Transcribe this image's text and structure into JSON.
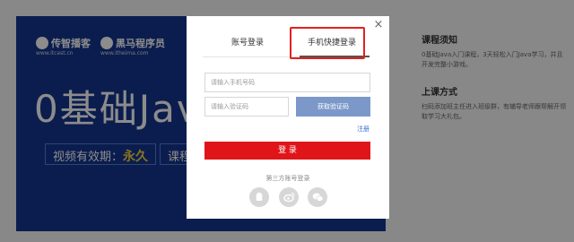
{
  "background": {
    "logo_a": "传智播客",
    "logo_a_sub": "www.itcast.cn",
    "logo_b": "黑马程序员",
    "logo_b_sub": "www.itheima.com",
    "headline": "0基础Jav",
    "validity_label": "视频有效期：",
    "validity_value": "永久",
    "course_label": "课程",
    "side": {
      "h1": "课程须知",
      "p1": "0基础Java入门课程，3天轻松入门Java学习，并且开发完整小游戏。",
      "h2": "上课方式",
      "p2": "扫码添加班主任进入班级群，有辅导老师跟帮解开领取学习大礼包。"
    }
  },
  "modal": {
    "close_glyph": "×",
    "tabs": [
      "账号登录",
      "手机快捷登录"
    ],
    "phone_placeholder": "请输入手机号码",
    "code_placeholder": "请输入验证码",
    "get_code_label": "获取验证码",
    "register_label": "注册",
    "login_label": "登 录",
    "third_party_label": "第三方账号登录",
    "social_icons": [
      "qq-icon",
      "weibo-icon",
      "wechat-icon"
    ]
  },
  "colors": {
    "accent_red": "#e0151a",
    "highlight_red": "#e0221f",
    "code_button": "#7b98c9",
    "banner_blue": "#14358f"
  }
}
